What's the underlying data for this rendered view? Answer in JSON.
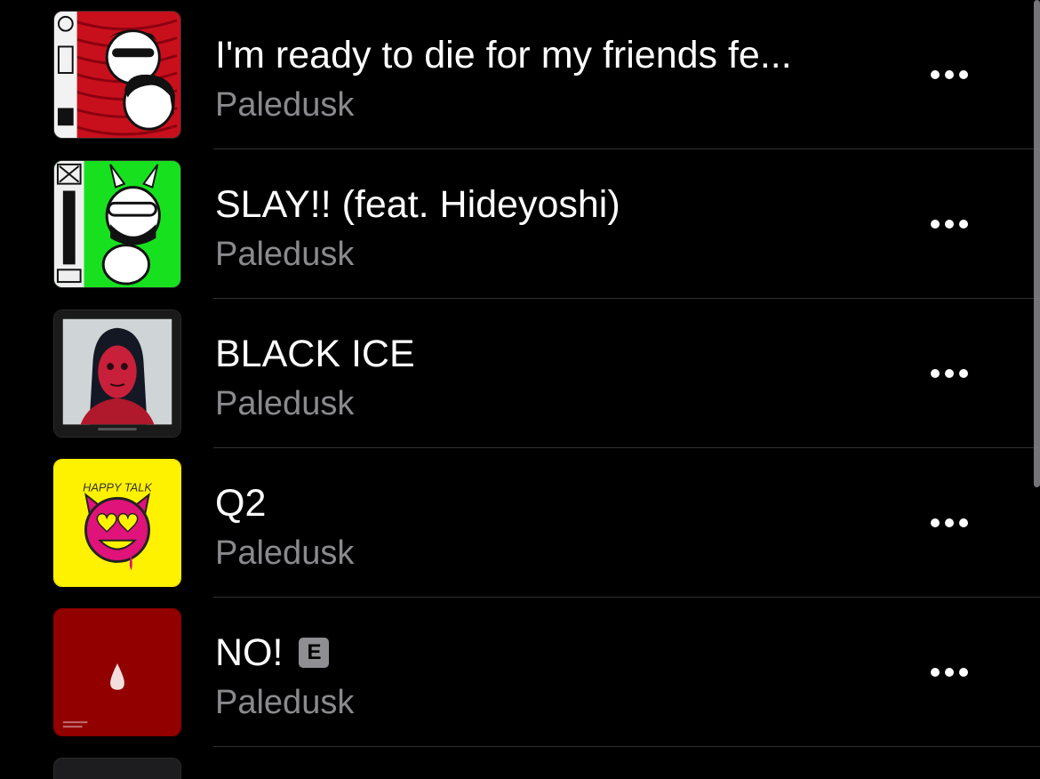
{
  "songs": [
    {
      "title": "I'm ready to die for my friends fe...",
      "artist": "Paledusk",
      "explicit": false,
      "artwork": "red-sticker-art"
    },
    {
      "title": "SLAY!! (feat. Hideyoshi)",
      "artist": "Paledusk",
      "explicit": false,
      "artwork": "green-paledusk-art"
    },
    {
      "title": "BLACK ICE",
      "artist": "Paledusk",
      "explicit": false,
      "artwork": "red-face-painting-art"
    },
    {
      "title": "Q2",
      "artist": "Paledusk",
      "explicit": false,
      "artwork": "yellow-happy-talk-art",
      "artwork_text": "HAPPY TALK"
    },
    {
      "title": "NO!",
      "artist": "Paledusk",
      "explicit": true,
      "explicit_label": "E",
      "artwork": "dark-red-drop-art"
    }
  ],
  "icons": {
    "more": "ellipsis-icon",
    "explicit": "explicit-badge"
  },
  "colors": {
    "background": "#000000",
    "title": "#ffffff",
    "subtitle": "#8a8a8e",
    "separator": "#303033",
    "explicit_badge": "#8e8e93"
  }
}
